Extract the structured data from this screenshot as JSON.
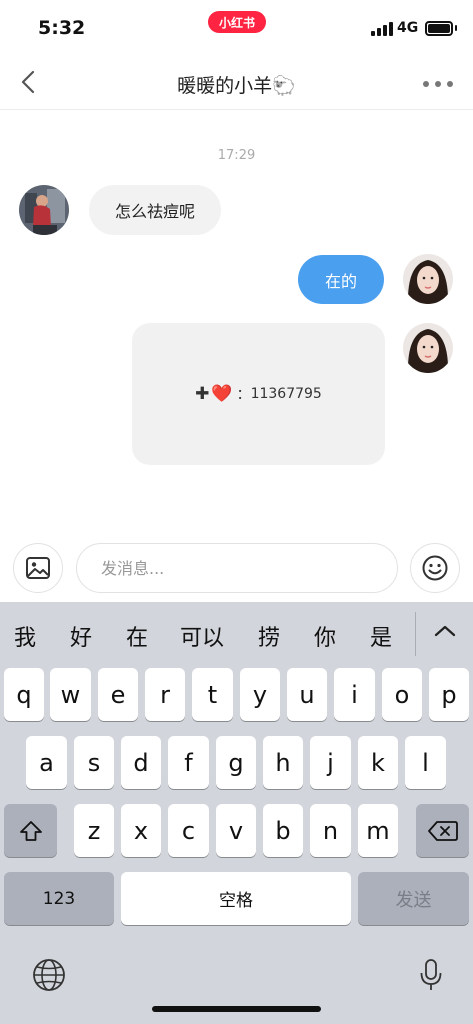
{
  "status_bar": {
    "time": "5:32",
    "app_badge": "小红书",
    "network": "4G"
  },
  "nav": {
    "title": "暖暖的小羊🐑",
    "back_icon": "chevron-left-icon",
    "more_icon": "more-dots-icon"
  },
  "chat": {
    "timestamp": "17:29",
    "messages": [
      {
        "side": "incoming",
        "text": "怎么祛痘呢"
      },
      {
        "side": "outgoing",
        "text": "在的"
      },
      {
        "side": "outgoing",
        "card": {
          "plus": "✚",
          "heart": "❤️",
          "colon": "：",
          "number": "11367795"
        }
      }
    ]
  },
  "input": {
    "placeholder": "发消息...",
    "value": ""
  },
  "keyboard": {
    "candidates": [
      "我",
      "好",
      "在",
      "可以",
      "捞",
      "你",
      "是"
    ],
    "row1": [
      "q",
      "w",
      "e",
      "r",
      "t",
      "y",
      "u",
      "i",
      "o",
      "p"
    ],
    "row2": [
      "a",
      "s",
      "d",
      "f",
      "g",
      "h",
      "j",
      "k",
      "l"
    ],
    "row3": [
      "z",
      "x",
      "c",
      "v",
      "b",
      "n",
      "m"
    ],
    "numbers_key": "123",
    "space_key": "空格",
    "send_key": "发送"
  },
  "colors": {
    "outgoing_bubble": "#4a9fef",
    "incoming_bubble": "#f2f2f2",
    "brand": "#ff2442",
    "keyboard_bg": "#d2d5db"
  }
}
